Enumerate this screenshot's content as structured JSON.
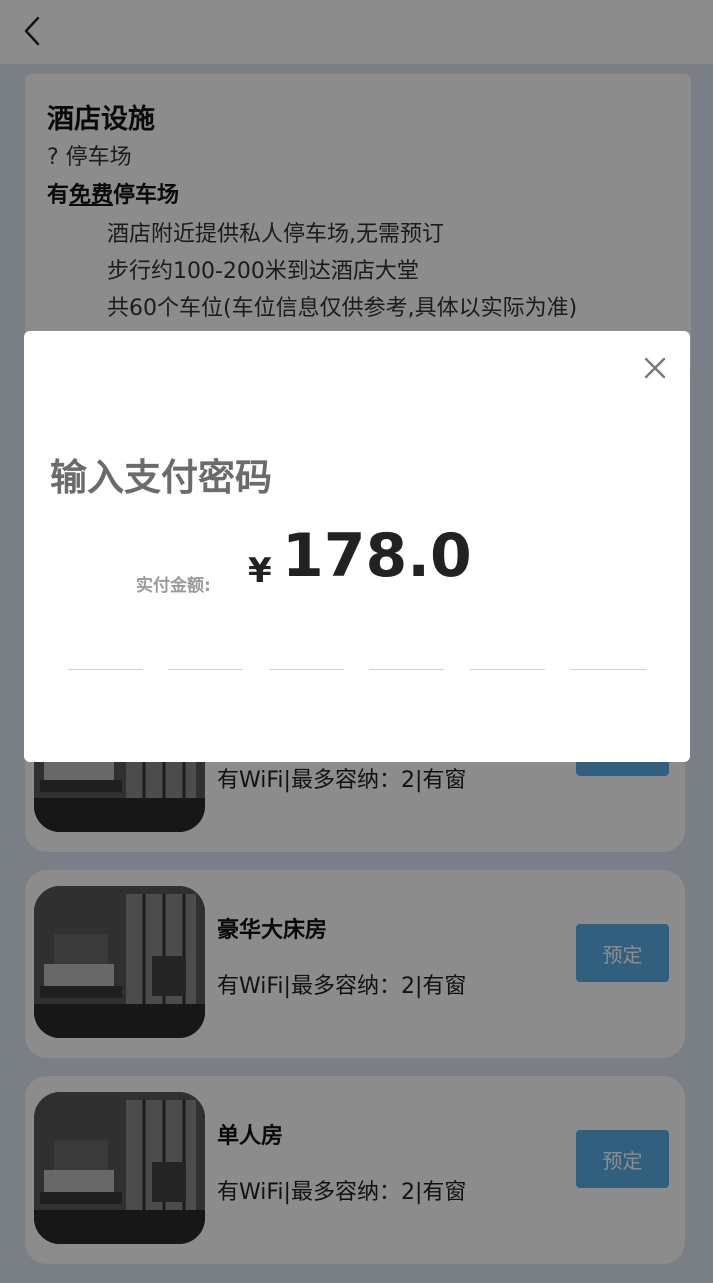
{
  "facility": {
    "title": "酒店设施",
    "category": "? 停车场",
    "heading_pre": "有",
    "heading_underline": "免费",
    "heading_post": "停车场",
    "lines": [
      "酒店附近提供私人停车场,无需预订",
      "步行约100-200米到达酒店大堂",
      "共60个车位(车位信息仅供参考,具体以实际为准)"
    ]
  },
  "rooms": [
    {
      "name": "",
      "desc": "有WiFi|最多容纳：2|有窗",
      "button": "预定"
    },
    {
      "name": "豪华大床房",
      "desc": "有WiFi|最多容纳：2|有窗",
      "button": "预定"
    },
    {
      "name": "单人房",
      "desc": "有WiFi|最多容纳：2|有窗",
      "button": "预定"
    }
  ],
  "modal": {
    "title": "输入支付密码",
    "amount_label": "实付金额:",
    "currency": "¥",
    "amount": "178.0",
    "password_slots": 6
  },
  "icons": {
    "back": "chevron-left-icon",
    "close": "close-icon"
  },
  "colors": {
    "page_bg": "#dfe7f2",
    "button": "#5ab0e8",
    "overlay": "rgba(0,0,0,0.45)"
  }
}
